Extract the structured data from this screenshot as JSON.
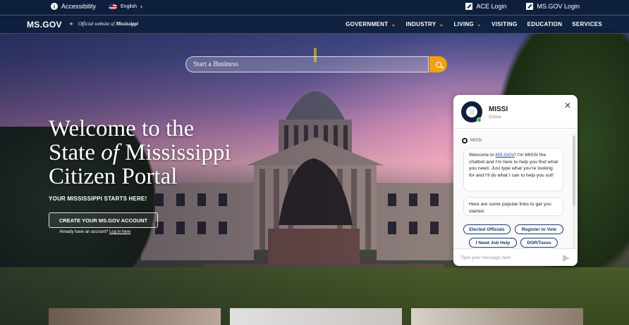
{
  "utility": {
    "accessibility": "Accessibility",
    "language": "English",
    "ace_login": "ACE Login",
    "msgov_login": "MS.GOV Login"
  },
  "nav": {
    "logo": "MS.GOV",
    "tagline_prefix": "Official website of",
    "tagline_state": "Mississippi",
    "links": [
      {
        "label": "GOVERNMENT",
        "dropdown": true
      },
      {
        "label": "INDUSTRY",
        "dropdown": true
      },
      {
        "label": "LIVING",
        "dropdown": true
      },
      {
        "label": "VISITING",
        "dropdown": false
      },
      {
        "label": "EDUCATION",
        "dropdown": false
      },
      {
        "label": "SERVICES",
        "dropdown": false
      }
    ]
  },
  "search": {
    "placeholder": "Start a Business"
  },
  "hero": {
    "line1": "Welcome to the",
    "line2a": "State ",
    "line2b": "of",
    "line2c": " Mississippi",
    "line3": "Citizen Portal",
    "subhead": "YOUR MISSISSIPPI STARTS HERE!",
    "create_button": "CREATE YOUR MS.GOV ACCOUNT",
    "already_text": "Already have an account? ",
    "login_link": "Log in here"
  },
  "chat": {
    "bot_name": "MISSI",
    "status": "Online",
    "sender": "MISSI",
    "msg1_pre": "Welcome to ",
    "msg1_link": "MS.GOV",
    "msg1_post": "! I'm MISSI the chatbot and I'm here to help you find what you need. Just type what you're looking for and I'll do what I can to help you out!",
    "msg2": "Here are some popular links to get you started.",
    "chips": [
      "Elected Officials",
      "Register to Vote",
      "I Need Job Help",
      "DOR/Taxes"
    ],
    "input_placeholder": "Type your message here"
  },
  "colors": {
    "navy": "#0d1f3c",
    "accent_orange": "#f2a20c",
    "chip_blue": "#1a3670",
    "online_green": "#36b24a"
  }
}
